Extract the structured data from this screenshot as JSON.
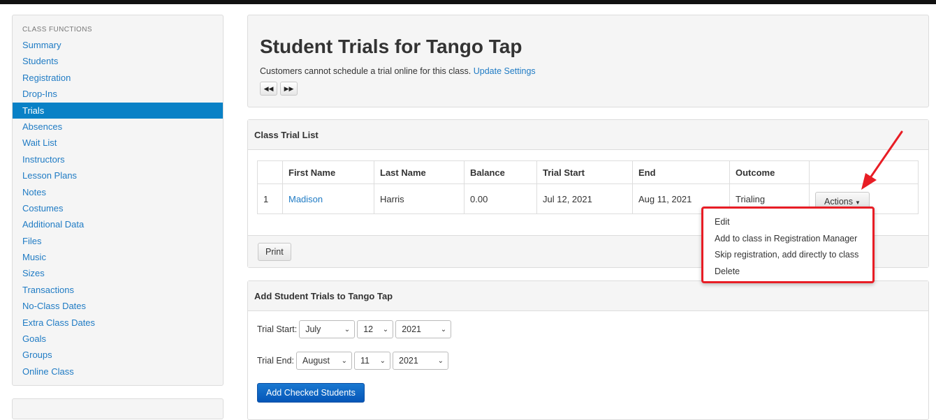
{
  "sidebar": {
    "header": "CLASS FUNCTIONS",
    "items": [
      {
        "label": "Summary"
      },
      {
        "label": "Students"
      },
      {
        "label": "Registration"
      },
      {
        "label": "Drop-Ins"
      },
      {
        "label": "Trials",
        "active": true
      },
      {
        "label": "Absences"
      },
      {
        "label": "Wait List"
      },
      {
        "label": "Instructors"
      },
      {
        "label": "Lesson Plans"
      },
      {
        "label": "Notes"
      },
      {
        "label": "Costumes"
      },
      {
        "label": "Additional Data"
      },
      {
        "label": "Files"
      },
      {
        "label": "Music"
      },
      {
        "label": "Sizes"
      },
      {
        "label": "Transactions"
      },
      {
        "label": "No-Class Dates"
      },
      {
        "label": "Extra Class Dates"
      },
      {
        "label": "Goals"
      },
      {
        "label": "Groups"
      },
      {
        "label": "Online Class"
      }
    ]
  },
  "page": {
    "title": "Student Trials for Tango Tap",
    "note": "Customers cannot schedule a trial online for this class.",
    "note_link": "Update Settings",
    "prev_icon": "◀◀",
    "next_icon": "▶▶"
  },
  "trial_list": {
    "title": "Class Trial List",
    "columns": [
      "",
      "First Name",
      "Last Name",
      "Balance",
      "Trial Start",
      "End",
      "Outcome",
      ""
    ],
    "rows": [
      {
        "num": "1",
        "first": "Madison",
        "last": "Harris",
        "balance": "0.00",
        "start": "Jul 12, 2021",
        "end": "Aug 11, 2021",
        "outcome": "Trialing",
        "actions": "Actions"
      }
    ],
    "print_label": "Print"
  },
  "actions_menu": {
    "items": [
      "Edit",
      "Add to class in Registration Manager",
      "Skip registration, add directly to class",
      "Delete"
    ]
  },
  "add_trials": {
    "title": "Add Student Trials to Tango Tap",
    "start_label": "Trial Start:",
    "start_month": "July",
    "start_day": "12",
    "start_year": "2021",
    "end_label": "Trial End:",
    "end_month": "August",
    "end_day": "11",
    "end_year": "2021",
    "submit_label": "Add Checked Students"
  },
  "colors": {
    "link": "#1f7bc4",
    "active_nav": "#0981c6",
    "highlight": "#e81d25",
    "primary_button": "#0556b8"
  }
}
